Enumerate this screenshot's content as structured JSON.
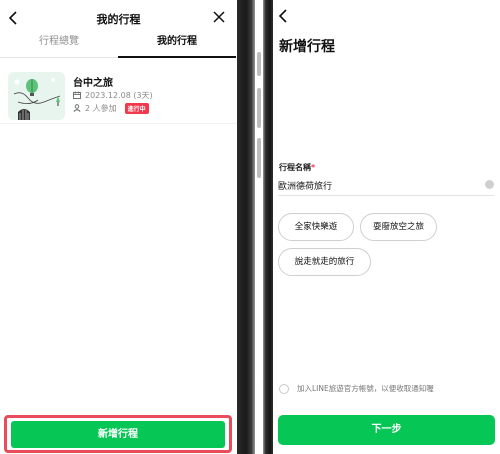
{
  "left": {
    "header": {
      "title": "我的行程"
    },
    "tabs": [
      {
        "label": "行程總覽"
      },
      {
        "label": "我的行程"
      }
    ],
    "trip": {
      "name": "台中之旅",
      "date": "2023.12.08 (3天)",
      "participants": "2 人參加",
      "status": "進行中"
    },
    "new_trip_button": "新增行程"
  },
  "right": {
    "title": "新增行程",
    "field": {
      "label": "行程名稱",
      "required_mark": "*",
      "value": "歐洲德荷旅行"
    },
    "suggestions": [
      {
        "label": "全家快樂遊"
      },
      {
        "label": "耍廢放空之旅"
      },
      {
        "label": "說走就走的旅行"
      }
    ],
    "optin_text": "加入LINE旅遊官方帳號，以便收取通知喔",
    "next_button": "下一步"
  },
  "colors": {
    "brand_green": "#06c755",
    "status_red": "#f2384d",
    "highlight_red": "#e94c5a"
  },
  "icons": [
    "back-arrow-icon",
    "close-icon",
    "calendar-icon",
    "person-icon",
    "clear-icon"
  ]
}
